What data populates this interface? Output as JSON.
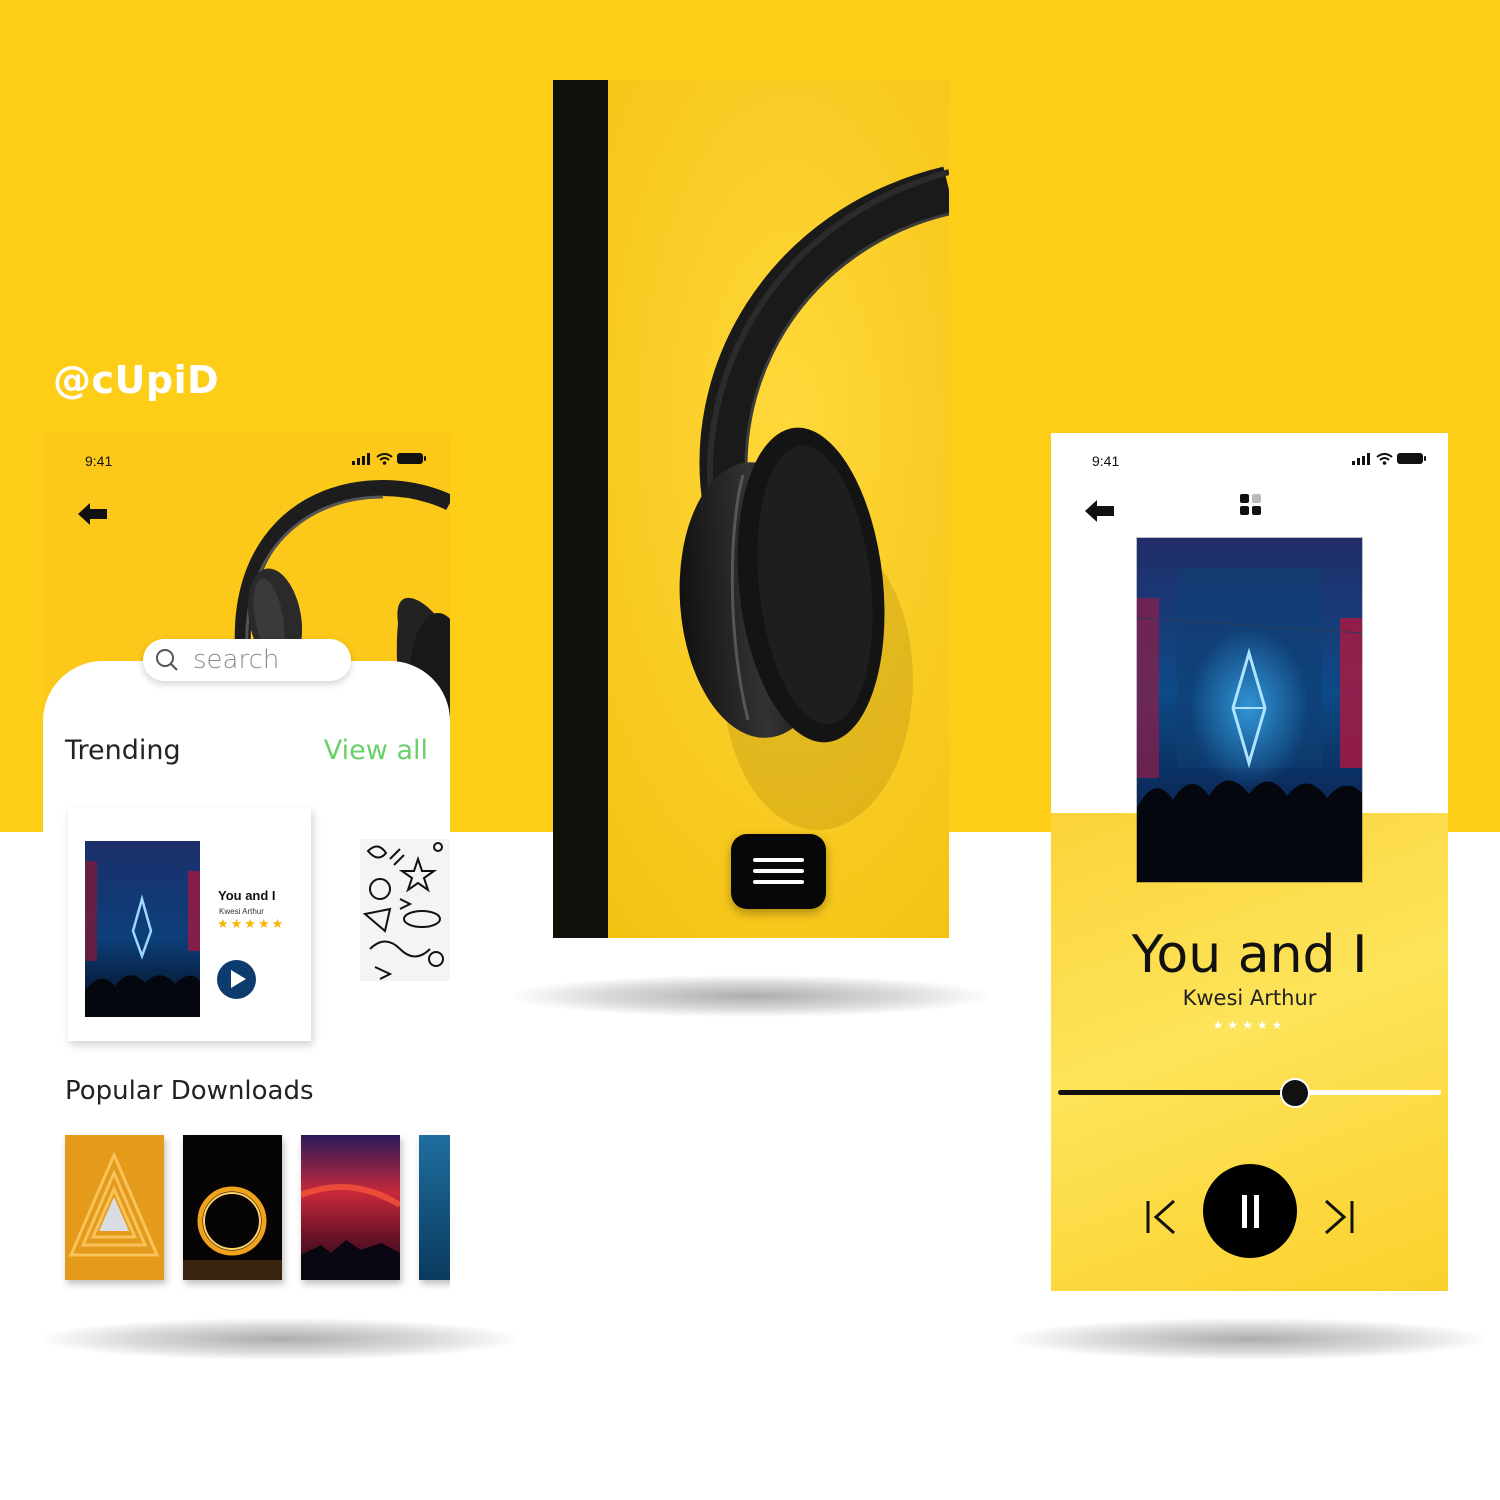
{
  "brand": "@cUpiD",
  "colors": {
    "background_yellow": "#fecd17",
    "accent_green": "#69d06c",
    "star_gold": "#f7b500",
    "play_blue": "#0d3b6e"
  },
  "left_screen": {
    "status_time": "9:41",
    "status_icons": [
      "signal-icon",
      "wifi-icon",
      "battery-icon"
    ],
    "back_icon": "back-arrow-icon",
    "search": {
      "icon": "search-icon",
      "placeholder": "search"
    },
    "trending": {
      "title": "Trending",
      "view_all": "View all",
      "card": {
        "title": "You and I",
        "artist": "Kwesi Arthur",
        "rating": 5,
        "stars": "★★★★★",
        "action_icon": "play-icon"
      },
      "next_card_art": "doodle-art"
    },
    "popular_downloads": {
      "title": "Popular Downloads",
      "items": [
        "orange-triangle-art",
        "ring-of-fire-art",
        "red-sunset-art",
        "blue-ocean-art"
      ]
    }
  },
  "center_screen": {
    "image": "headphones-on-yellow",
    "menu_icon": "hamburger-menu-icon"
  },
  "right_screen": {
    "status_time": "9:41",
    "status_icons": [
      "signal-icon",
      "wifi-icon",
      "battery-icon"
    ],
    "back_icon": "back-arrow-icon",
    "grid_icon": "grid-icon",
    "now_playing": {
      "title": "You and I",
      "artist": "Kwesi Arthur",
      "rating": 5,
      "stars": "★★★★★",
      "progress": 0.62
    },
    "controls": [
      "previous-icon",
      "pause-icon",
      "next-icon"
    ]
  }
}
